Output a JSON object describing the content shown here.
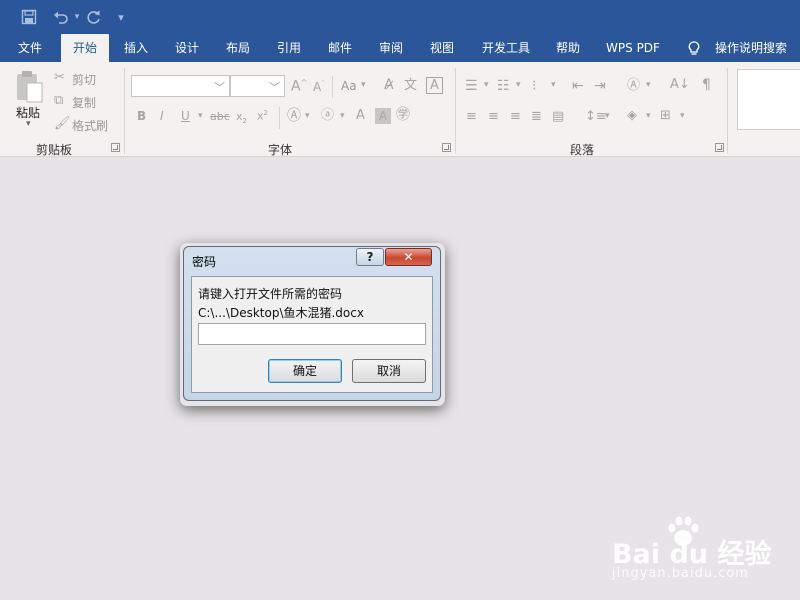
{
  "qat": {
    "save_icon": "save-icon",
    "undo_icon": "undo-icon",
    "redo_icon": "redo-icon",
    "customize_icon": "customize-qat-icon"
  },
  "tabs": [
    "文件",
    "开始",
    "插入",
    "设计",
    "布局",
    "引用",
    "邮件",
    "审阅",
    "视图",
    "开发工具",
    "帮助",
    "WPS PDF"
  ],
  "active_tab": "开始",
  "tell_me": "操作说明搜索",
  "clipboard": {
    "paste": "粘贴",
    "cut": "剪切",
    "copy": "复制",
    "format_painter": "格式刷",
    "group_label": "剪贴板"
  },
  "font": {
    "font_name_value": "",
    "font_size_value": "",
    "change_case": "Aa",
    "group_label": "字体"
  },
  "paragraph": {
    "group_label": "段落"
  },
  "dialog": {
    "title": "密码",
    "help_label": "?",
    "close_label": "✕",
    "prompt": "请键入打开文件所需的密码",
    "file_path": "C:\\...\\Desktop\\鱼木混猪.docx",
    "password_value": "",
    "ok_label": "确定",
    "cancel_label": "取消"
  },
  "watermark": {
    "logo": "Bai du 经验",
    "url": "jingyan.baidu.com"
  },
  "colors": {
    "ribbon_blue": "#2b579a",
    "ribbon_bg": "#f3f2f1",
    "workspace": "#e6e4e6"
  }
}
